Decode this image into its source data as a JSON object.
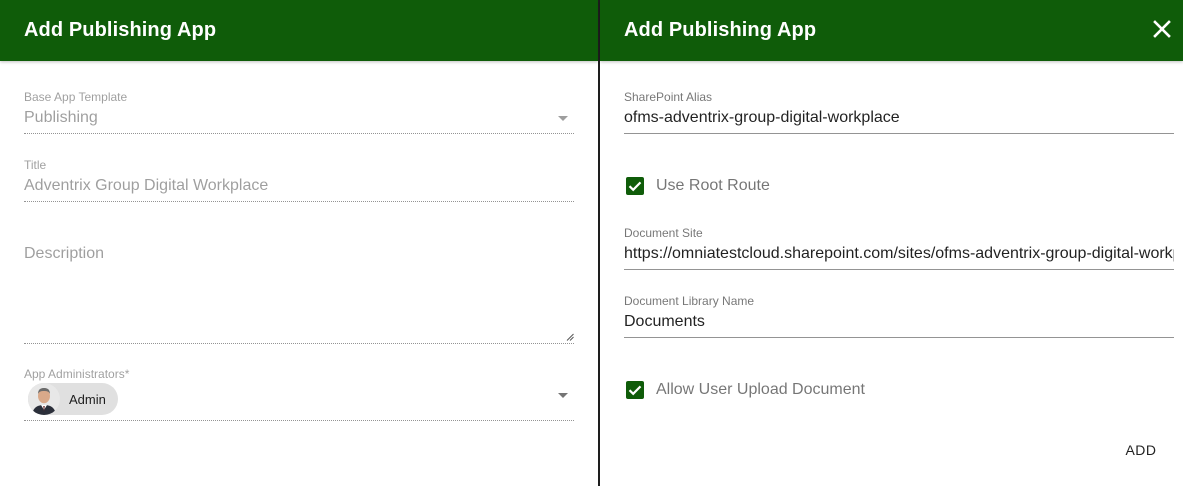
{
  "left_panel": {
    "title": "Add Publishing App",
    "base_template": {
      "label": "Base App Template",
      "value": "Publishing"
    },
    "title_field": {
      "label": "Title",
      "value": "Adventrix Group Digital Workplace"
    },
    "description": {
      "placeholder": "Description"
    },
    "administrators": {
      "label": "App Administrators*",
      "chips": [
        "Admin"
      ]
    }
  },
  "right_panel": {
    "title": "Add Publishing App",
    "close_icon": "close-icon",
    "sharepoint_alias": {
      "label": "SharePoint Alias",
      "value": "ofms-adventrix-group-digital-workplace"
    },
    "use_root_route": {
      "label": "Use Root Route",
      "checked": true
    },
    "document_site": {
      "label": "Document Site",
      "value": "https://omniatestcloud.sharepoint.com/sites/ofms-adventrix-group-digital-workplace"
    },
    "document_library": {
      "label": "Document Library Name",
      "value": "Documents"
    },
    "allow_upload": {
      "label": "Allow User Upload Document",
      "checked": true
    },
    "add_label": "ADD"
  },
  "colors": {
    "header": "#0f5c09",
    "accent": "#0f5c09",
    "divider": "#1e1e1e"
  }
}
